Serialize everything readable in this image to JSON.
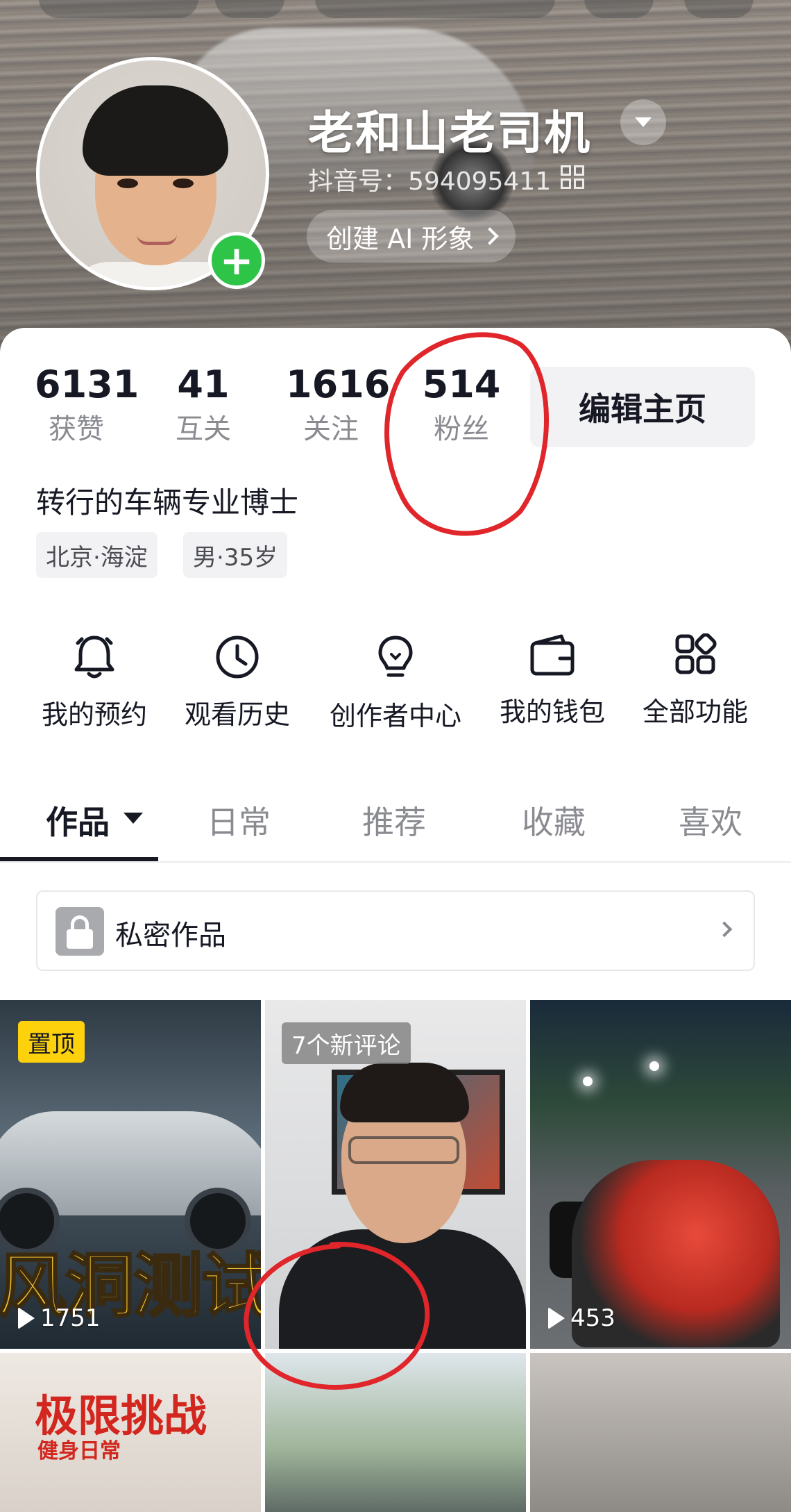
{
  "profile": {
    "nickname": "老和山老司机",
    "douyin_id": "抖音号：594095411",
    "ai_button": "创建 AI 形象"
  },
  "stats": [
    {
      "value": "6131",
      "label": "获赞"
    },
    {
      "value": "41",
      "label": "互关"
    },
    {
      "value": "1616",
      "label": "关注"
    },
    {
      "value": "514",
      "label": "粉丝"
    }
  ],
  "edit_button": "编辑主页",
  "bio": "转行的车辆专业博士",
  "tags": [
    "北京·海淀",
    "男·35岁"
  ],
  "functions": [
    {
      "label": "我的预约",
      "icon": "bell-icon"
    },
    {
      "label": "观看历史",
      "icon": "clock-icon"
    },
    {
      "label": "创作者中心",
      "icon": "lightbulb-icon"
    },
    {
      "label": "我的钱包",
      "icon": "wallet-icon"
    },
    {
      "label": "全部功能",
      "icon": "grid-icon"
    }
  ],
  "tabs": [
    "作品",
    "日常",
    "推荐",
    "收藏",
    "喜欢"
  ],
  "active_tab": "作品",
  "private_works": "私密作品",
  "videos": [
    {
      "badge": "置顶",
      "overlay_text": "风洞测试",
      "plays": "1751"
    },
    {
      "badge": "7个新评论",
      "plays": ""
    },
    {
      "badge": "",
      "plays": "453"
    },
    {
      "overlay_text": "极限挑战",
      "overlay_sub": "健身日常"
    },
    {},
    {}
  ],
  "colors": {
    "accent_green": "#2ec448",
    "pin_yellow": "#fdd20d",
    "annotation_red": "#e0262a"
  }
}
